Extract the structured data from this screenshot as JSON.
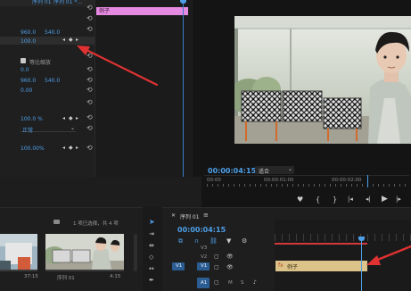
{
  "effect_controls": {
    "header_label": "序列 01",
    "header_clip": "序列 01 *...",
    "position": {
      "x": "960.0",
      "y": "540.0"
    },
    "scale": "100.0",
    "uniform_scale_label": "等比缩放",
    "rotation": "0.0",
    "anchor": {
      "x": "960.0",
      "y": "540.0"
    },
    "anti_flicker": "0.00",
    "opacity": "100.0 %",
    "blend_mode": "正常",
    "time_remap": "100.00%",
    "mini_clip_label": "例子"
  },
  "program_monitor": {
    "timecode": "00:00:04:15",
    "fit_label": "适合",
    "ruler": {
      "start": "00:00",
      "mid": "00:00:01:00",
      "end": "00:00:02:00"
    }
  },
  "project": {
    "status": "1 项已选择，共 4 项",
    "thumb1_time": "37:15",
    "thumb2_label": "序列 01",
    "thumb2_time": "4:15"
  },
  "timeline": {
    "tab_label": "序列 01",
    "timecode": "00:00:04:15",
    "tracks": {
      "v3": "V3",
      "v2": "V2",
      "v1": "V1",
      "a1": "A1",
      "src_v1": "V1",
      "src_a1": "A1",
      "m": "M",
      "s": "S"
    },
    "clip_label": "例子"
  },
  "colors": {
    "accent_blue": "#4e9fe8",
    "clip_pink": "#e58ae0",
    "clip_sand": "#dcc38a",
    "arrow_red": "#e03232"
  }
}
